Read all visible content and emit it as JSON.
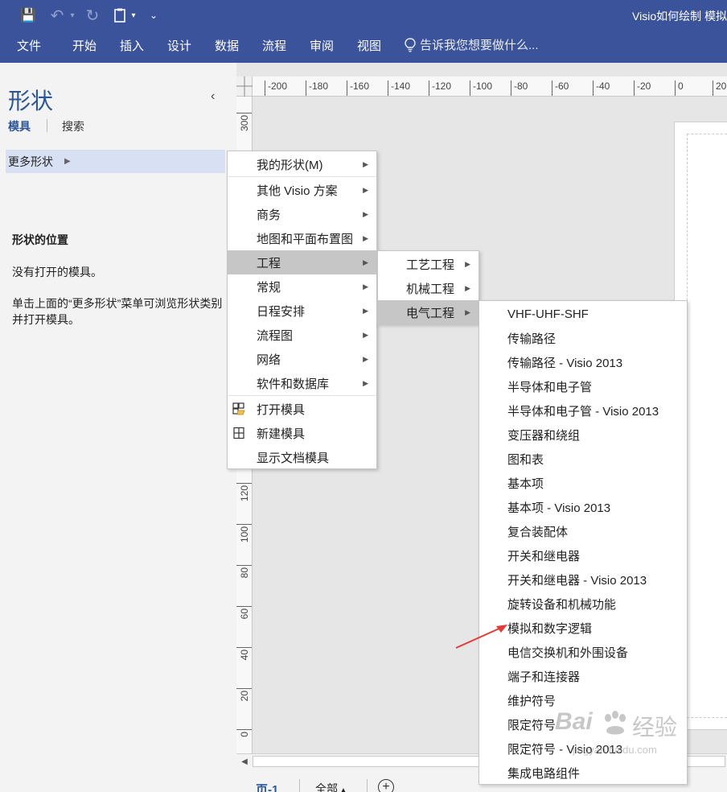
{
  "titlebar": {
    "app_title": "Visio如何绘制 模拟",
    "save_glyph": "💾",
    "undo_glyph": "↶",
    "redo_glyph": "↻",
    "dropdown_glyph": "▾",
    "customize_glyph": "⌄"
  },
  "ribbon": {
    "tabs": [
      "文件",
      "开始",
      "插入",
      "设计",
      "数据",
      "流程",
      "审阅",
      "视图"
    ],
    "tell_me": "告诉我您想要做什么..."
  },
  "shapes_pane": {
    "title": "形状",
    "collapse_glyph": "‹",
    "tab_stencils": "模具",
    "tab_search": "搜索",
    "more_shapes": "更多形状",
    "more_shapes_arrow": "▶",
    "location_heading": "形状的位置",
    "no_stencil": "没有打开的模具。",
    "hint": "单击上面的“更多形状”菜单可浏览形状类别并打开模具。"
  },
  "ruler": {
    "horizontal": [
      "-200",
      "-180",
      "-160",
      "-140",
      "-120",
      "-100",
      "-80",
      "-60",
      "-40",
      "-20",
      "0",
      "20"
    ],
    "vertical": [
      "300",
      "120",
      "100",
      "80",
      "60",
      "40",
      "20",
      "0"
    ]
  },
  "page_bar": {
    "page_tab": "页-1",
    "all_pages": "全部",
    "all_pages_arrow": "▲",
    "add_page_glyph": "+"
  },
  "scroll": {
    "left_glyph": "◀"
  },
  "menu_more_shapes": {
    "items": [
      {
        "label": "我的形状(M)",
        "submenu": true
      },
      {
        "label": "其他 Visio 方案",
        "submenu": true
      },
      {
        "label": "商务",
        "submenu": true
      },
      {
        "label": "地图和平面布置图",
        "submenu": true
      },
      {
        "label": "工程",
        "submenu": true,
        "highlighted": true
      },
      {
        "label": "常规",
        "submenu": true
      },
      {
        "label": "日程安排",
        "submenu": true
      },
      {
        "label": "流程图",
        "submenu": true
      },
      {
        "label": "网络",
        "submenu": true
      },
      {
        "label": "软件和数据库",
        "submenu": true
      }
    ],
    "actions": [
      {
        "label": "打开模具",
        "icon": "open-stencil-icon"
      },
      {
        "label": "新建模具",
        "icon": "new-stencil-icon"
      },
      {
        "label": "显示文档模具",
        "icon": ""
      }
    ],
    "chevron": "▶"
  },
  "menu_engineering": {
    "items": [
      {
        "label": "工艺工程"
      },
      {
        "label": "机械工程"
      },
      {
        "label": "电气工程",
        "highlighted": true
      }
    ]
  },
  "menu_electrical": {
    "items": [
      "VHF-UHF-SHF",
      "传输路径",
      "传输路径 - Visio 2013",
      "半导体和电子管",
      "半导体和电子管 - Visio 2013",
      "变压器和绕组",
      "图和表",
      "基本项",
      "基本项 - Visio 2013",
      "复合装配体",
      "开关和继电器",
      "开关和继电器 - Visio 2013",
      "旋转设备和机械功能",
      "模拟和数字逻辑",
      "电信交换机和外围设备",
      "端子和连接器",
      "维护符号",
      "限定符号",
      "限定符号 - Visio 2013",
      "集成电路组件"
    ]
  },
  "watermark": {
    "brand": "Bai",
    "brand_cn": "经验",
    "url": "jingyan.baidu.com"
  },
  "colors": {
    "ribbon_blue": "#3a539b",
    "accent_blue": "#2b579a",
    "menu_highlight": "#c6c6c6",
    "annotation_red": "#e53935"
  }
}
